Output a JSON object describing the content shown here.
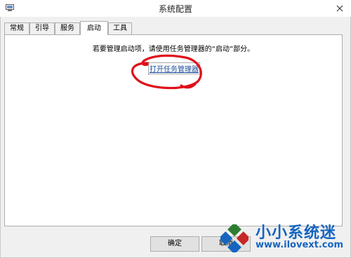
{
  "window": {
    "title": "系统配置"
  },
  "tabs": [
    {
      "label": "常规"
    },
    {
      "label": "引导"
    },
    {
      "label": "服务"
    },
    {
      "label": "启动",
      "active": true
    },
    {
      "label": "工具"
    }
  ],
  "startup": {
    "info": "若要管理启动项，请使用任务管理器的“启动”部分。",
    "link": "打开任务管理器"
  },
  "buttons": {
    "ok": "确定",
    "cancel": "取消"
  },
  "watermark": {
    "brand": "小小系统迷",
    "url": "www.ilovext.com"
  },
  "colors": {
    "link": "#1a4c9a",
    "annotation": "#e0101a",
    "watermark": "#1565c0"
  }
}
